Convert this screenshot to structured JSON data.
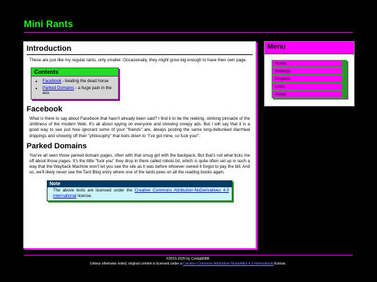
{
  "site": {
    "title": "Mini Rants"
  },
  "intro": {
    "heading": "Introduction",
    "text": "These are just like my regular rants, only smaller. Occasionally, they might grow big enough to have their own page."
  },
  "contents": {
    "title": "Contents",
    "items": [
      {
        "link": "Facebook",
        "rest": " - beating the dead horse"
      },
      {
        "link": "Parked Domains",
        "rest": " - a huge pain in the ass"
      }
    ]
  },
  "facebook": {
    "heading": "Facebook",
    "text": "What is there to say about Facebook that hasn't already been said? I find it to be the reeking, stinking pinnacle of the shittiness of the modern Web. It's all about spying on everyone and showing creepy ads. But I will say that it is a good way to see just how ignorant some of your \"friends\" are, always posting the same long-debunked diarrheal drippings and showing off their \"philosophy\" that boils down to \"I've got mine, so fuck you!\"."
  },
  "parked": {
    "heading": "Parked Domains",
    "text": "You've all seen those parked domain pages, often with that smug girl with the backpack. But that's not what ticks me off about those pages. It's the little \"fuck you\" they drop in there called robots.txt, which is quite often set up in such a way that the Wayback Machine won't let you see the site as it was before whoever owned it forgot to pay the bill. And so, we'll likely never see the Tard Blog entry where one of the tards pees on all the reading books again."
  },
  "note": {
    "title": "Note",
    "pre": "The above texts are licensed under the ",
    "link": "Creative Commons Attribution-NoDerivatives 4.0 International",
    "post": " license."
  },
  "menu": {
    "title": "Menu",
    "items": [
      "Home",
      "Writings",
      "Projects",
      "Links",
      "About"
    ]
  },
  "footer": {
    "copyright": "©2015-2020 by Czeba8088.",
    "license_pre": "Unless otherwise noted, original content is licensed under a ",
    "license_link": "Creative Commons Attribution-ShareAlike 4.0 International",
    "license_post": " license."
  }
}
